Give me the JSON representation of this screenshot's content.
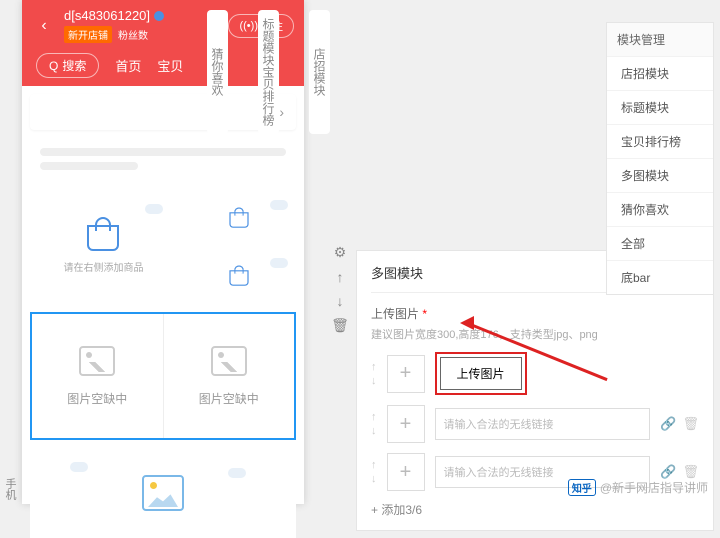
{
  "phone": {
    "title": "d[s483061220]",
    "badge": "新开店铺",
    "fans_label": "粉丝数",
    "follow": "关注",
    "search": "搜索",
    "nav1": "首页",
    "nav2": "宝贝",
    "add_hint": "请在右侧添加商品",
    "placeholder": "图片空缺中"
  },
  "side": {
    "s1": "店招模块",
    "s2": "标题模块宝贝排行榜",
    "s3": "猜你喜欢"
  },
  "panel": {
    "title": "多图模块",
    "upload_label": "上传图片",
    "hint": "建议图片宽度300,高度176，支持类型jpg、png",
    "upload_btn": "上传图片",
    "link_placeholder": "请输入合法的无线链接",
    "add_more": "添加3/6"
  },
  "modmgr": {
    "head": "模块管理",
    "items": [
      "店招模块",
      "标题模块",
      "宝贝排行榜",
      "多图模块",
      "猜你喜欢",
      "全部",
      "底bar"
    ]
  },
  "watermark": {
    "logo": "知乎",
    "text": "@新手网店指导讲师"
  },
  "leftlabel": "手机"
}
